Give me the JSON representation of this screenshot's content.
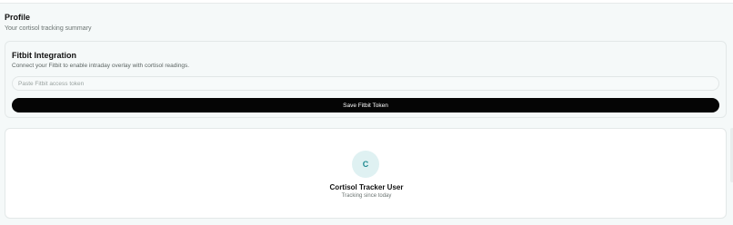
{
  "header": {
    "title": "Profile",
    "subtitle": "Your cortisol tracking summary"
  },
  "fitbit": {
    "title": "Fitbit Integration",
    "description": "Connect your Fitbit to enable intraday overlay with cortisol readings.",
    "token_placeholder": "Paste Fitbit access token",
    "token_value": "",
    "save_label": "Save Fitbit Token"
  },
  "profile": {
    "avatar_initial": "C",
    "user_name": "Cortisol Tracker User",
    "since_text": "Tracking since today"
  },
  "colors": {
    "background": "#f5f9f9",
    "button": "#050505",
    "avatar_bg": "#dff1f2",
    "avatar_text": "#1f8a91"
  }
}
